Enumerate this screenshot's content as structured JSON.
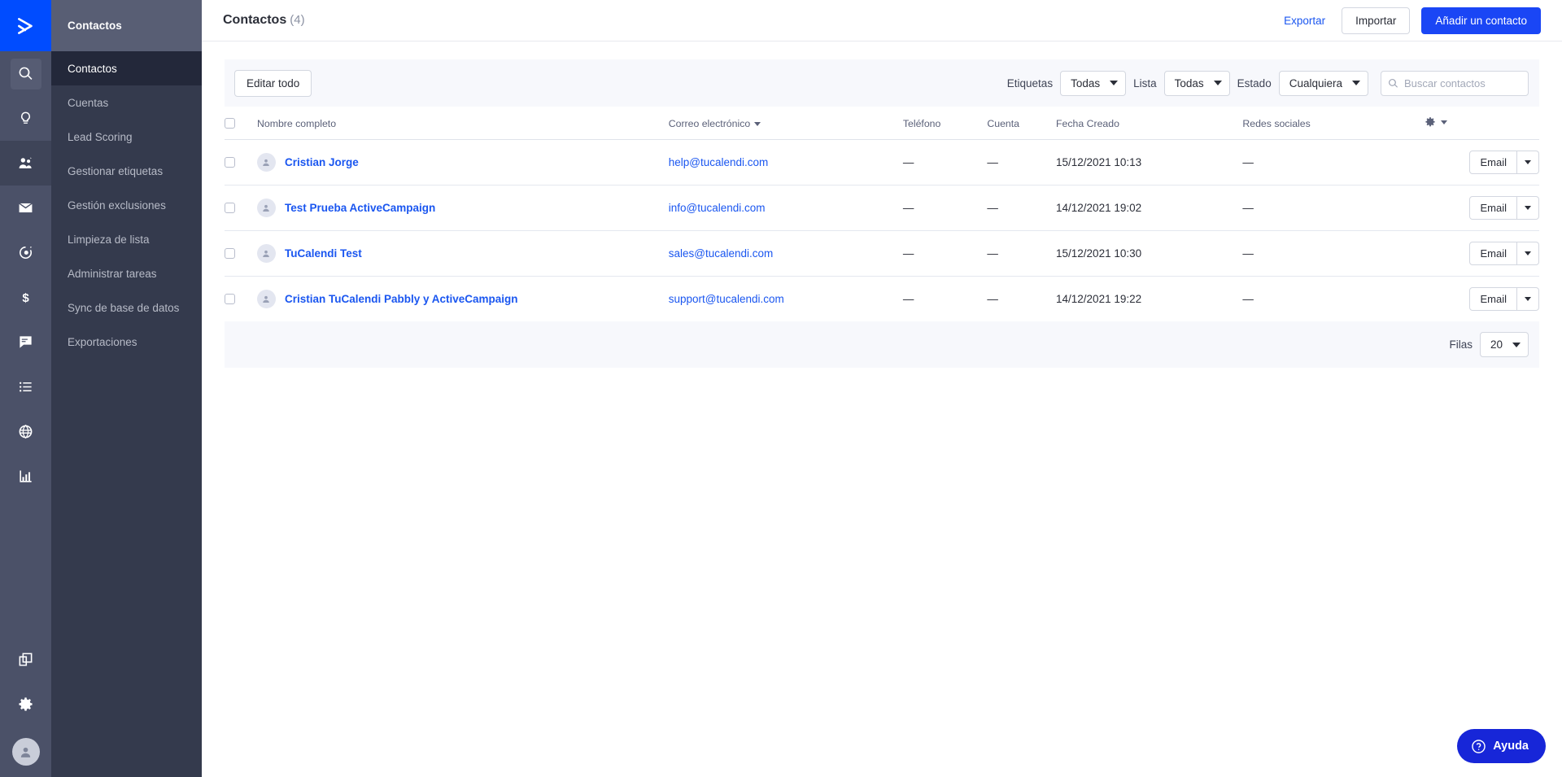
{
  "rail": {
    "logo_icon": "activecampaign-logo-icon",
    "items": [
      {
        "icon": "search-icon",
        "name": "search",
        "selected": true
      },
      {
        "icon": "lightbulb-icon",
        "name": "campaigns-ideas",
        "selected": false
      },
      {
        "icon": "contacts-people-icon",
        "name": "contacts",
        "selected": false,
        "active": true
      },
      {
        "icon": "envelope-icon",
        "name": "campaigns",
        "selected": false
      },
      {
        "icon": "automations-gear-icon",
        "name": "automations",
        "selected": false
      },
      {
        "icon": "dollar-icon",
        "name": "deals",
        "selected": false
      },
      {
        "icon": "conversations-icon",
        "name": "conversations",
        "selected": false
      },
      {
        "icon": "list-icon",
        "name": "lists",
        "selected": false
      },
      {
        "icon": "globe-icon",
        "name": "website",
        "selected": false
      },
      {
        "icon": "bar-chart-icon",
        "name": "reports",
        "selected": false
      }
    ],
    "bottom": [
      {
        "icon": "apps-copy-icon",
        "name": "apps"
      },
      {
        "icon": "gear-icon",
        "name": "settings"
      }
    ],
    "avatar_icon": "user-avatar-icon"
  },
  "subnav": {
    "header": "Contactos",
    "items": [
      {
        "label": "Contactos",
        "active": true
      },
      {
        "label": "Cuentas",
        "active": false
      },
      {
        "label": "Lead Scoring",
        "active": false
      },
      {
        "label": "Gestionar etiquetas",
        "active": false
      },
      {
        "label": "Gestión exclusiones",
        "active": false
      },
      {
        "label": "Limpieza de lista",
        "active": false
      },
      {
        "label": "Administrar tareas",
        "active": false
      },
      {
        "label": "Sync de base de datos",
        "active": false
      },
      {
        "label": "Exportaciones",
        "active": false
      }
    ]
  },
  "topbar": {
    "title": "Contactos",
    "count": "(4)",
    "export_label": "Exportar",
    "import_label": "Importar",
    "add_contact_label": "Añadir un contacto"
  },
  "filterbar": {
    "edit_all_label": "Editar todo",
    "tags_label": "Etiquetas",
    "tags_value": "Todas",
    "list_label": "Lista",
    "list_value": "Todas",
    "status_label": "Estado",
    "status_value": "Cualquiera",
    "search_placeholder": "Buscar contactos",
    "search_value": "",
    "search_icon": "search-icon"
  },
  "table": {
    "columns": {
      "name": "Nombre completo",
      "email": "Correo electrónico",
      "phone": "Teléfono",
      "account": "Cuenta",
      "date": "Fecha Creado",
      "social": "Redes sociales"
    },
    "sorted_column": "email",
    "settings_icon": "gear-icon",
    "rows": [
      {
        "name": "Cristian Jorge",
        "email": "help@tucalendi.com",
        "phone": "—",
        "account": "—",
        "date": "15/12/2021 10:13",
        "social": "—",
        "action_label": "Email",
        "checked": false
      },
      {
        "name": "Test Prueba ActiveCampaign",
        "email": "info@tucalendi.com",
        "phone": "—",
        "account": "—",
        "date": "14/12/2021 19:02",
        "social": "—",
        "action_label": "Email",
        "checked": false
      },
      {
        "name": "TuCalendi Test",
        "email": "sales@tucalendi.com",
        "phone": "—",
        "account": "—",
        "date": "15/12/2021 10:30",
        "social": "—",
        "action_label": "Email",
        "checked": false
      },
      {
        "name": "Cristian TuCalendi Pabbly y ActiveCampaign",
        "email": "support@tucalendi.com",
        "phone": "—",
        "account": "—",
        "date": "14/12/2021 19:22",
        "social": "—",
        "action_label": "Email",
        "checked": false
      }
    ]
  },
  "footer": {
    "rows_label": "Filas",
    "rows_value": "20"
  },
  "help": {
    "label": "Ayuda",
    "icon": "question-circle-icon"
  },
  "colors": {
    "brand_blue": "#004cff",
    "link_blue": "#1a56f0",
    "primary_btn": "#1a46f5",
    "help_blue": "#1726d8",
    "rail_bg": "#4b5168",
    "subnav_bg": "#343a4d",
    "subnav_active": "#23283a",
    "subnav_header": "#585e74",
    "panel_grey": "#f7f8fc"
  }
}
